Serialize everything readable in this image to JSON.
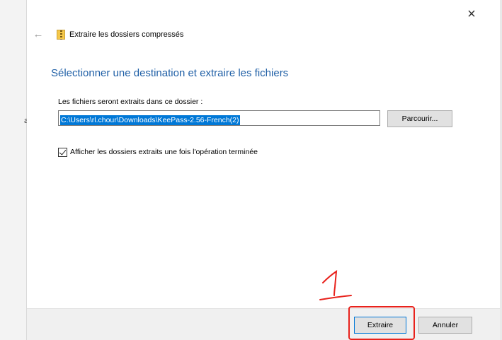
{
  "background": {
    "edge_text": "a"
  },
  "dialog": {
    "close_icon": "×",
    "back_icon": "←",
    "title": "Extraire les dossiers compressés",
    "heading": "Sélectionner une destination et extraire les fichiers",
    "path_label": "Les fichiers seront extraits dans ce dossier :",
    "path_value": "C:\\Users\\rl.chour\\Downloads\\KeePass-2.56-French(2)",
    "browse_label": "Parcourir...",
    "checkbox_label": "Afficher les dossiers extraits une fois l'opération terminée",
    "checkbox_checked": true,
    "extract_label": "Extraire",
    "cancel_label": "Annuler"
  },
  "annotation": {
    "number": "1",
    "color": "#e8221c"
  },
  "colors": {
    "heading": "#1f5fa6",
    "selection": "#0078d7",
    "footer": "#f0f0f0"
  }
}
